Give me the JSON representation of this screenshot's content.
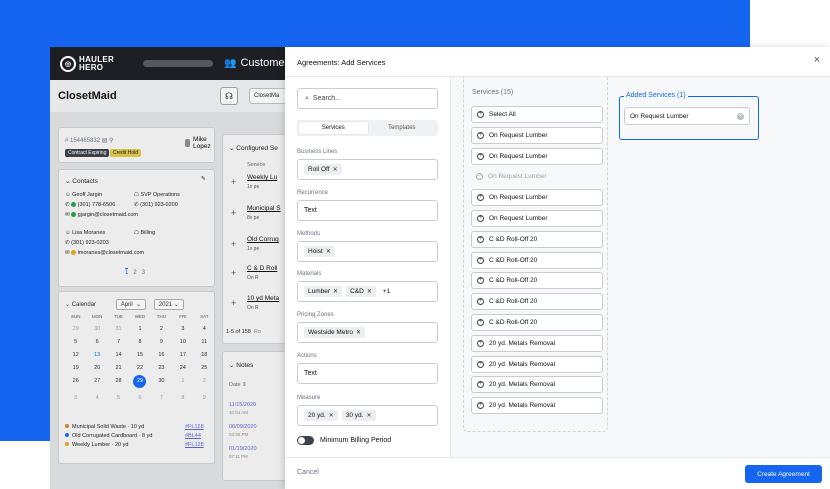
{
  "app": {
    "logo_line1": "HAULER",
    "logo_line2": "HERO",
    "nav_section": "Customer",
    "company_title": "ClosetMaid",
    "header_chip": "ClosetMa",
    "customer_id": "# 154465832",
    "owner_name": "Mike Lopez",
    "badge_expiring": "Contract Expiring",
    "badge_hold": "Credit Hold",
    "contacts_title": "Contacts",
    "contacts": [
      {
        "name": "Geoff Jargin",
        "role": "SVP Operations",
        "phone1": "(301) 778-6506",
        "phone2": "(301) 923-0200",
        "email": "gjargin@closetmaid.com"
      },
      {
        "name": "Lisa Moranes",
        "role": "Billing",
        "phone1": "(301) 923-0203",
        "email": "lmoranes@closetmaid.com"
      }
    ],
    "contacts_pages": [
      "1",
      "2",
      "3"
    ],
    "calendar": {
      "title": "Calendar",
      "month": "April",
      "year": "2021",
      "dow": [
        "SUN",
        "MON",
        "TUE",
        "WED",
        "THU",
        "FRI",
        "SAT"
      ],
      "weeks": [
        [
          "29",
          "30",
          "31",
          "1",
          "2",
          "3",
          "4"
        ],
        [
          "5",
          "6",
          "7",
          "8",
          "9",
          "10",
          "11"
        ],
        [
          "12",
          "13",
          "14",
          "15",
          "16",
          "17",
          "18"
        ],
        [
          "19",
          "20",
          "21",
          "22",
          "23",
          "24",
          "25"
        ],
        [
          "26",
          "27",
          "28",
          "29",
          "30",
          "1",
          "2"
        ],
        [
          "3",
          "4",
          "5",
          "6",
          "7",
          "8",
          "9"
        ]
      ],
      "legend": [
        {
          "label": "Municipal Solid Waste · 10 yd",
          "link": "#FL128",
          "color": "#e07b16"
        },
        {
          "label": "Old Corrugated Cardboard · 8 yd",
          "link": "#BL44",
          "color": "#1565f0"
        },
        {
          "label": "Weekly Lumber · 20 yd",
          "link": "#FL128",
          "color": "#e0a316"
        }
      ]
    },
    "configured_title": "Configured Se",
    "service_col": "Service",
    "service_rows": [
      {
        "name": "Weekly Lu",
        "sub": "1x pe"
      },
      {
        "name": "Municipal S",
        "sub": "8x pe"
      },
      {
        "name": "Old Corrug",
        "sub": "1x pe"
      },
      {
        "name": "C & D Roll",
        "sub": "On R"
      },
      {
        "name": "10 yd Meta",
        "sub": "On R"
      }
    ],
    "pagination": "1-5 of 158",
    "pagination_suffix": "Ro",
    "notes_title": "Notes",
    "notes_col": "Date",
    "notes": [
      {
        "date": "11/15/2020",
        "time": "10:04 AM"
      },
      {
        "date": "06/09/2020",
        "time": "03:30 PM"
      },
      {
        "date": "01/19/2020",
        "time": "07:11 PM"
      }
    ]
  },
  "modal": {
    "title": "Agreements: Add Services",
    "close_label": "×",
    "search_placeholder": "Search...",
    "tabs": [
      "Services",
      "Templates"
    ],
    "fields": [
      {
        "label": "Business Lines",
        "chips": [
          "Roll Off"
        ]
      },
      {
        "label": "Recurrence",
        "text": "Text"
      },
      {
        "label": "Methods",
        "chips": [
          "Hoist"
        ]
      },
      {
        "label": "Materials",
        "chips": [
          "Lumber",
          "C&D"
        ],
        "more": "+1"
      },
      {
        "label": "Pricing Zones",
        "chips": [
          "Westside Metro"
        ]
      },
      {
        "label": "Actions",
        "text": "Text"
      },
      {
        "label": "Measure",
        "chips": [
          "20 yd.",
          "30 yd."
        ]
      }
    ],
    "toggle_label": "Minimum Billing Period",
    "services_title": "Services (15)",
    "services": [
      {
        "label": "Select All",
        "disabled": false
      },
      {
        "label": "On Request Lumber",
        "disabled": false
      },
      {
        "label": "On Request Lumber",
        "disabled": false
      },
      {
        "label": "On Request Lumber",
        "disabled": true
      },
      {
        "label": "On Request Lumber",
        "disabled": false
      },
      {
        "label": "On Request Lumber",
        "disabled": false
      },
      {
        "label": "C &D Roll-Off 20",
        "disabled": false
      },
      {
        "label": "C &D Roll-Off 20",
        "disabled": false
      },
      {
        "label": "C &D Roll-Off 20",
        "disabled": false
      },
      {
        "label": "C &D Roll-Off 20",
        "disabled": false
      },
      {
        "label": "C &D Roll-Off 20",
        "disabled": false
      },
      {
        "label": "20 yd. Metals Removal",
        "disabled": false
      },
      {
        "label": "20 yd. Metals Removal",
        "disabled": false
      },
      {
        "label": "20 yd. Metals Removal",
        "disabled": false
      },
      {
        "label": "20 yd. Metals Removal",
        "disabled": false
      }
    ],
    "added_title": "Added Services (1)",
    "added": [
      "On Request Lumber"
    ],
    "cancel_label": "Cancel",
    "create_label": "Create Agreement"
  },
  "colors": {
    "brand_blue": "#1565f0",
    "nav_dark": "#1d1f24"
  }
}
